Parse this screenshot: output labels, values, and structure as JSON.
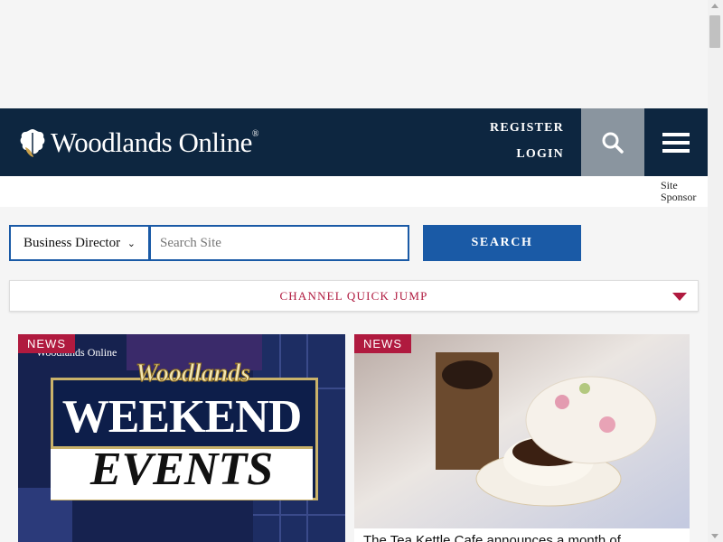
{
  "header": {
    "logo_text": "Woodlands Online",
    "logo_mark": "®",
    "register_label": "REGISTER",
    "login_label": "LOGIN"
  },
  "sponsor": {
    "label": "Site Sponsor"
  },
  "search": {
    "directory_selected": "Business Director",
    "placeholder": "Search Site",
    "button_label": "SEARCH"
  },
  "quick_jump": {
    "label": "CHANNEL QUICK JUMP"
  },
  "cards": [
    {
      "badge": "NEWS",
      "image_brand": "Woodlands Online",
      "image_title_script": "Woodlands",
      "image_title_main": "WEEKEND",
      "image_title_sub": "EVENTS"
    },
    {
      "badge": "NEWS",
      "caption": "The Tea Kettle Cafe announces a month of"
    }
  ],
  "colors": {
    "header_bg": "#0d2640",
    "accent_blue": "#1a5aa6",
    "accent_red": "#b01a3f",
    "search_toggle_bg": "#8a959f"
  },
  "icons": {
    "logo": "oak-leaf-icon",
    "search": "search-icon",
    "menu": "hamburger-menu-icon",
    "quick_jump": "caret-down-icon"
  }
}
